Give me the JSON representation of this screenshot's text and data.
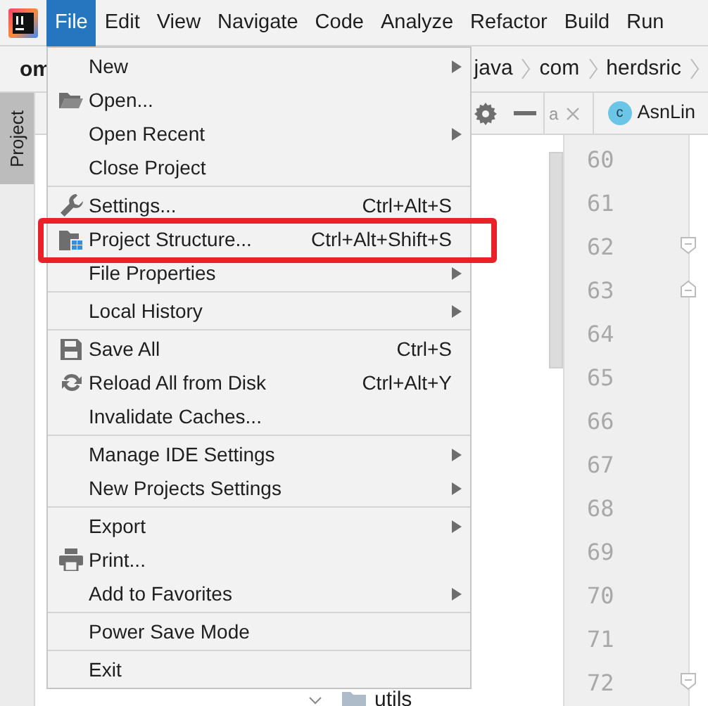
{
  "menubar": [
    {
      "label": "File",
      "selected": true
    },
    {
      "label": "Edit",
      "selected": false
    },
    {
      "label": "View",
      "selected": false
    },
    {
      "label": "Navigate",
      "selected": false
    },
    {
      "label": "Code",
      "selected": false
    },
    {
      "label": "Analyze",
      "selected": false
    },
    {
      "label": "Refactor",
      "selected": false
    },
    {
      "label": "Build",
      "selected": false
    },
    {
      "label": "Run",
      "selected": false
    }
  ],
  "project_name": "om",
  "breadcrumbs": [
    "java",
    "com",
    "herdsric"
  ],
  "tool_window_tab": "Project",
  "editor_tabs": [
    {
      "label": "a",
      "kind": "fragment"
    },
    {
      "label": "AsnLin",
      "kind": "class",
      "badge": "c"
    }
  ],
  "line_numbers": [
    {
      "number": "60",
      "kind": "plain"
    },
    {
      "number": "61",
      "kind": "plain"
    },
    {
      "number": "62",
      "kind": "foldend"
    },
    {
      "number": "63",
      "kind": "foldstart"
    },
    {
      "number": "64",
      "kind": "plain"
    },
    {
      "number": "65",
      "kind": "plain"
    },
    {
      "number": "66",
      "kind": "plain"
    },
    {
      "number": "67",
      "kind": "plain"
    },
    {
      "number": "68",
      "kind": "plain"
    },
    {
      "number": "69",
      "kind": "plain"
    },
    {
      "number": "70",
      "kind": "plain"
    },
    {
      "number": "71",
      "kind": "plain"
    },
    {
      "number": "72",
      "kind": "foldend"
    }
  ],
  "tree_item": {
    "label": "utils",
    "expanded": true
  },
  "file_menu": {
    "items": [
      {
        "kind": "plain",
        "label": "New",
        "submenu": true,
        "highlighted": false
      },
      {
        "kind": "folder",
        "label": "Open...",
        "submenu": false,
        "highlighted": false
      },
      {
        "kind": "plain",
        "label": "Open Recent",
        "submenu": true,
        "highlighted": false
      },
      {
        "kind": "plain",
        "label": "Close Project",
        "submenu": false,
        "highlighted": false
      },
      {
        "kind": "separator"
      },
      {
        "kind": "wrench",
        "label": "Settings...",
        "shortcut": "Ctrl+Alt+S",
        "submenu": false,
        "highlighted": false
      },
      {
        "kind": "structure",
        "label": "Project Structure...",
        "shortcut": "Ctrl+Alt+Shift+S",
        "submenu": false,
        "highlighted": true
      },
      {
        "kind": "plain",
        "label": "File Properties",
        "submenu": true,
        "highlighted": false
      },
      {
        "kind": "separator"
      },
      {
        "kind": "plain",
        "label": "Local History",
        "submenu": true,
        "highlighted": false
      },
      {
        "kind": "separator"
      },
      {
        "kind": "save",
        "label": "Save All",
        "shortcut": "Ctrl+S",
        "submenu": false,
        "highlighted": false
      },
      {
        "kind": "reload",
        "label": "Reload All from Disk",
        "shortcut": "Ctrl+Alt+Y",
        "submenu": false,
        "highlighted": false
      },
      {
        "kind": "plain",
        "label": "Invalidate Caches...",
        "submenu": false,
        "highlighted": false
      },
      {
        "kind": "separator"
      },
      {
        "kind": "plain",
        "label": "Manage IDE Settings",
        "submenu": true,
        "highlighted": false
      },
      {
        "kind": "plain",
        "label": "New Projects Settings",
        "submenu": true,
        "highlighted": false
      },
      {
        "kind": "separator"
      },
      {
        "kind": "plain",
        "label": "Export",
        "submenu": true,
        "highlighted": false
      },
      {
        "kind": "print",
        "label": "Print...",
        "submenu": false,
        "highlighted": false
      },
      {
        "kind": "plain",
        "label": "Add to Favorites",
        "submenu": true,
        "highlighted": false
      },
      {
        "kind": "separator"
      },
      {
        "kind": "plain",
        "label": "Power Save Mode",
        "submenu": false,
        "highlighted": false
      },
      {
        "kind": "separator"
      },
      {
        "kind": "plain",
        "label": "Exit",
        "submenu": false,
        "highlighted": false
      }
    ]
  }
}
